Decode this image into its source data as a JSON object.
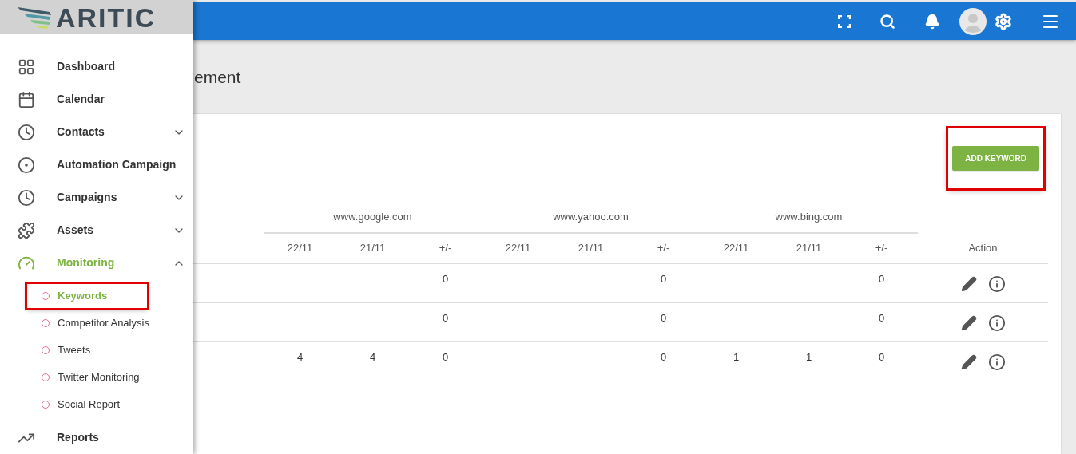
{
  "logo": {
    "text": "ARITIC"
  },
  "sidebar": {
    "items": [
      {
        "label": "Dashboard",
        "selected": false
      },
      {
        "label": "Calendar",
        "selected": false
      },
      {
        "label": "Contacts",
        "selected": false,
        "expanded": false
      },
      {
        "label": "Automation Campaign",
        "selected": false
      },
      {
        "label": "Campaigns",
        "selected": false,
        "expanded": false
      },
      {
        "label": "Assets",
        "selected": false,
        "expanded": false
      },
      {
        "label": "Monitoring",
        "selected": true,
        "expanded": true,
        "children": [
          {
            "label": "Keywords",
            "selected": true,
            "highlighted": true
          },
          {
            "label": "Competitor Analysis",
            "selected": false,
            "highlighted": false
          },
          {
            "label": "Tweets",
            "selected": false,
            "highlighted": false
          },
          {
            "label": "Twitter Monitoring",
            "selected": false,
            "highlighted": false
          },
          {
            "label": "Social Report",
            "selected": false,
            "highlighted": false
          }
        ]
      },
      {
        "label": "Reports",
        "selected": false
      }
    ]
  },
  "page": {
    "title": "ement"
  },
  "add_button": {
    "label": "ADD KEYWORD",
    "highlighted": true
  },
  "table": {
    "groups": [
      "www.google.com",
      "www.yahoo.com",
      "www.bing.com"
    ],
    "columns": [
      "22/11",
      "21/11",
      "+/-",
      "22/11",
      "21/11",
      "+/-",
      "22/11",
      "21/11",
      "+/-"
    ],
    "action_column": "Action",
    "rows": [
      {
        "cells": [
          null,
          null,
          "0",
          null,
          null,
          "0",
          null,
          null,
          "0"
        ]
      },
      {
        "cells": [
          null,
          null,
          "0",
          null,
          null,
          "0",
          null,
          null,
          "0"
        ]
      },
      {
        "cells": [
          "4",
          "4",
          "0",
          null,
          null,
          "0",
          "1",
          "1",
          "0"
        ]
      }
    ]
  }
}
